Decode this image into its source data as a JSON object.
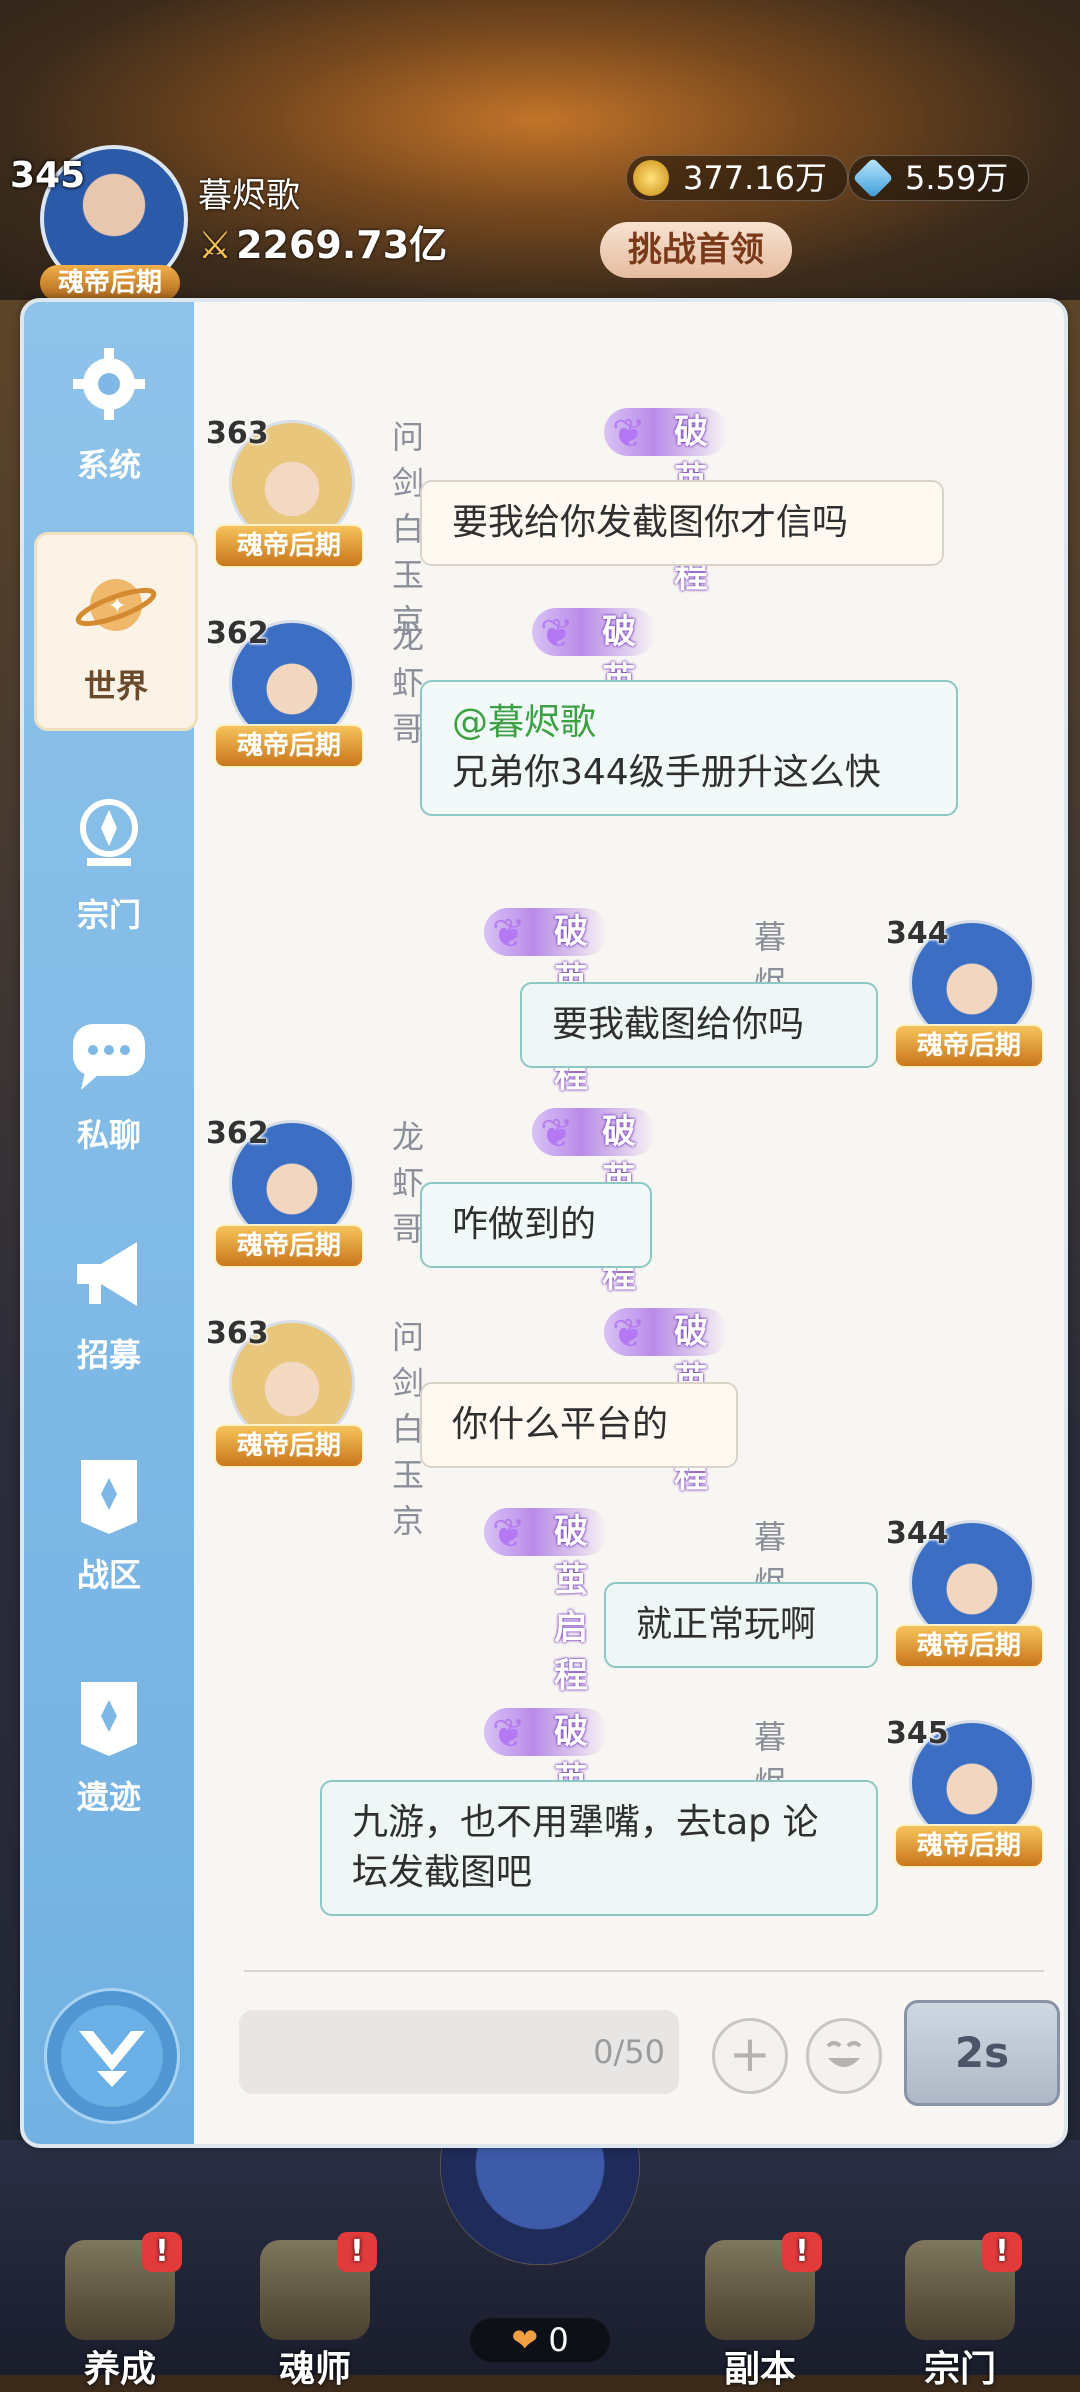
{
  "hud": {
    "level": "345",
    "name": "暮烬歌",
    "power": "2269.73亿",
    "rank": "魂帝后期",
    "gold": "377.16万",
    "gems": "5.59万",
    "challenge_label": "挑战首领"
  },
  "sidebar": {
    "items": [
      {
        "label": "系统"
      },
      {
        "label": "世界"
      },
      {
        "label": "宗门"
      },
      {
        "label": "私聊"
      },
      {
        "label": "招募"
      },
      {
        "label": "战区"
      },
      {
        "label": "遗迹"
      }
    ]
  },
  "chat": {
    "messages": [
      {
        "level": "363",
        "name": "问剑白玉京",
        "title": "破茧启程",
        "rank": "魂帝后期",
        "text": "要我给你发截图你才信吗"
      },
      {
        "level": "362",
        "name": "龙虾哥",
        "title": "破茧启程",
        "rank": "魂帝后期",
        "mention": "@暮烬歌",
        "text": "兄弟你344级手册升这么快"
      },
      {
        "level": "344",
        "name": "暮烬歌",
        "title": "破茧启程",
        "rank": "魂帝后期",
        "text": "要我截图给你吗"
      },
      {
        "level": "362",
        "name": "龙虾哥",
        "title": "破茧启程",
        "rank": "魂帝后期",
        "text": "咋做到的"
      },
      {
        "level": "363",
        "name": "问剑白玉京",
        "title": "破茧启程",
        "rank": "魂帝后期",
        "text": "你什么平台的"
      },
      {
        "level": "344",
        "name": "暮烬歌",
        "title": "破茧启程",
        "rank": "魂帝后期",
        "text": "就正常玩啊"
      },
      {
        "level": "345",
        "name": "暮烬歌",
        "title": "破茧启程",
        "rank": "魂帝后期",
        "text": "九游，也不用犟嘴，去tap 论坛发截图吧"
      }
    ],
    "input_counter": "0/50",
    "plus_label": "+",
    "send_label": "2s"
  },
  "bottom_nav": {
    "items": [
      {
        "label": "养成",
        "badge": "!"
      },
      {
        "label": "魂师",
        "badge": "!"
      },
      {
        "label": "副本",
        "badge": "!"
      },
      {
        "label": "宗门",
        "badge": "!"
      }
    ],
    "count": "0"
  },
  "colors": {
    "sidebar": "#7fb8e6",
    "panel": "#f8f6f2",
    "mention": "#3da144",
    "rank_badge": "#e09a32"
  }
}
